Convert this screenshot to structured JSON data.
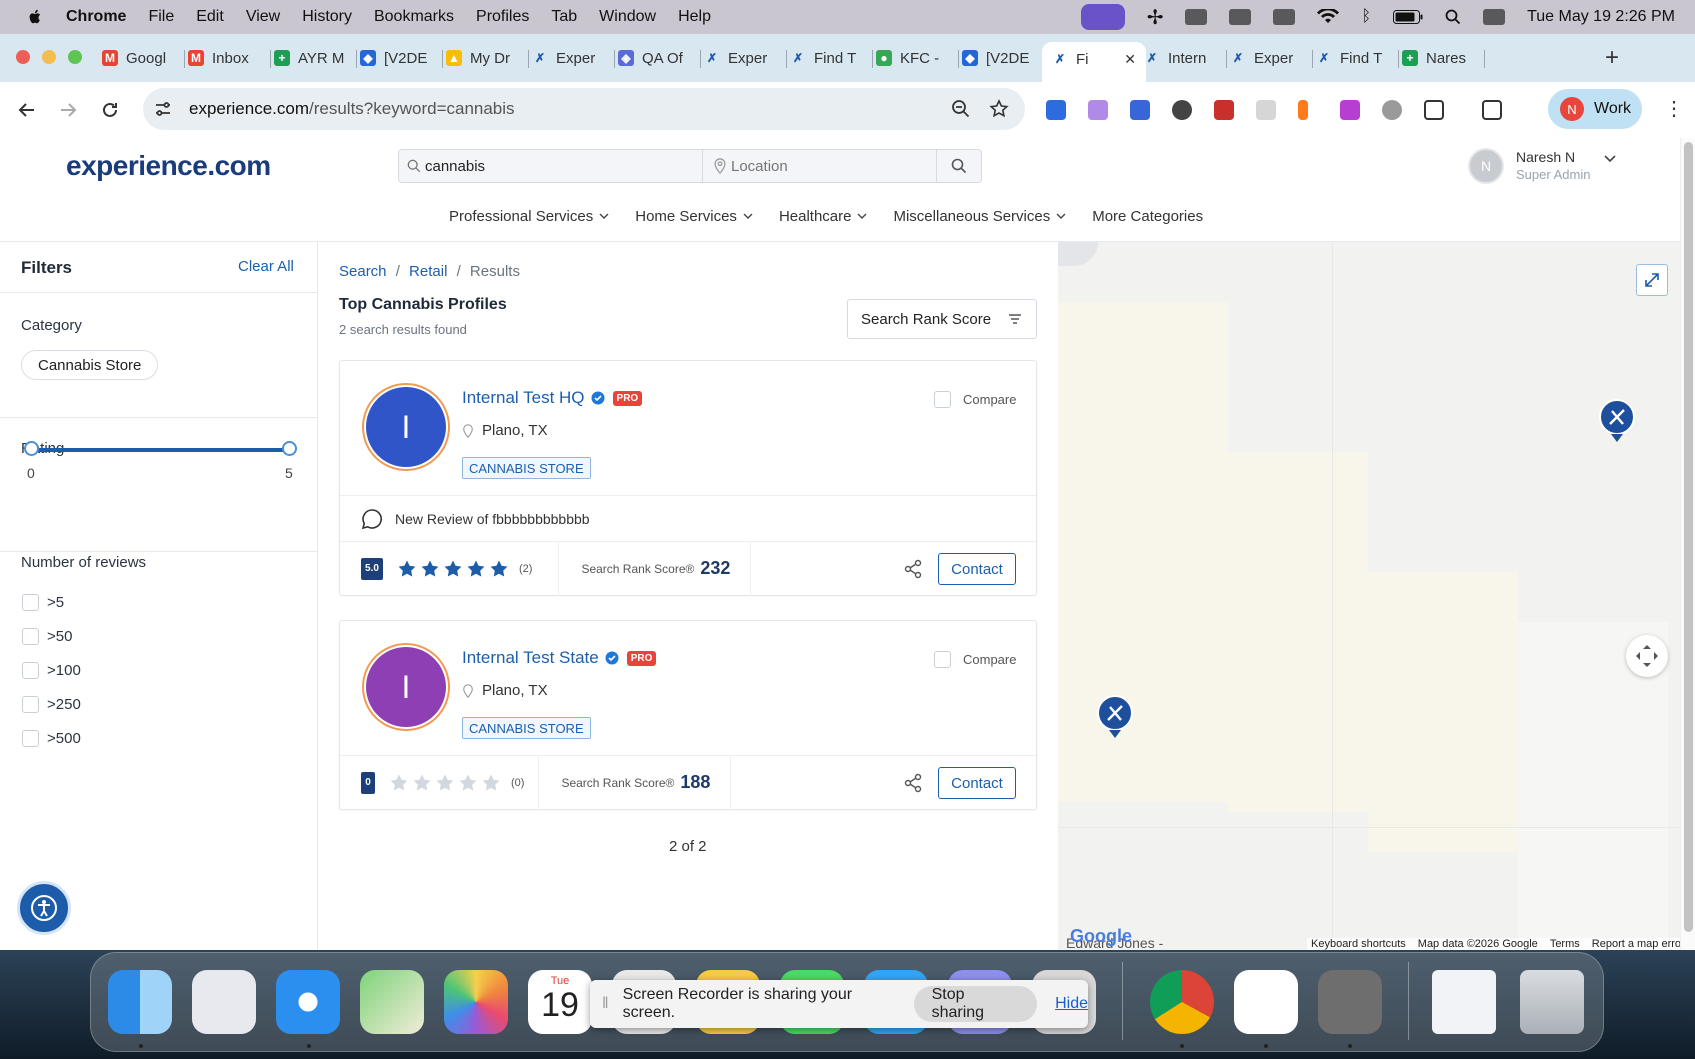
{
  "menubar": {
    "app": "Chrome",
    "items": [
      "File",
      "Edit",
      "View",
      "History",
      "Bookmarks",
      "Profiles",
      "Tab",
      "Window",
      "Help"
    ],
    "clock": "Tue May 19  2:26 PM"
  },
  "tabs": [
    {
      "label": "Googl",
      "icon": "gmail-icon"
    },
    {
      "label": "Inbox",
      "icon": "gmail-icon"
    },
    {
      "label": "AYR M",
      "icon": "sheets-icon"
    },
    {
      "label": "[V2DE",
      "icon": "jira-icon"
    },
    {
      "label": "My Dr",
      "icon": "drive-icon"
    },
    {
      "label": "Exper",
      "icon": "experience-icon"
    },
    {
      "label": "QA Of",
      "icon": "shield-icon"
    },
    {
      "label": "Exper",
      "icon": "experience-icon"
    },
    {
      "label": "Find T",
      "icon": "experience-icon"
    },
    {
      "label": "KFC -",
      "icon": "maps-icon"
    },
    {
      "label": "[V2DE",
      "icon": "jira-icon"
    },
    {
      "label": "Fi",
      "icon": "experience-icon",
      "active": true
    },
    {
      "label": "Intern",
      "icon": "experience-icon"
    },
    {
      "label": "Exper",
      "icon": "experience-icon"
    },
    {
      "label": "Find T",
      "icon": "experience-icon"
    },
    {
      "label": "Nares",
      "icon": "sheets-icon"
    }
  ],
  "omnibox": {
    "domain": "experience.com",
    "path": "/results?keyword=cannabis"
  },
  "profile_button": {
    "initial": "N",
    "label": "Work"
  },
  "site": {
    "logo": "experience.com",
    "search": {
      "keyword": "cannabis",
      "location_placeholder": "Location"
    },
    "user": {
      "initial": "N",
      "name": "Naresh N",
      "role": "Super Admin"
    },
    "categories": [
      "Professional Services",
      "Home Services",
      "Healthcare",
      "Miscellaneous Services",
      "More Categories"
    ]
  },
  "filters": {
    "title": "Filters",
    "clear_all": "Clear All",
    "category_title": "Category",
    "category_chip": "Cannabis Store",
    "rating_title": "Rating",
    "rating_min": "0",
    "rating_max": "5",
    "reviews_title": "Number of reviews",
    "review_options": [
      ">5",
      ">50",
      ">100",
      ">250",
      ">500"
    ]
  },
  "results": {
    "breadcrumb": [
      "Search",
      "Retail",
      "Results"
    ],
    "title": "Top Cannabis Profiles",
    "count": "2 search results found",
    "sort_label": "Search Rank Score",
    "pager": "2 of 2",
    "compare_label": "Compare",
    "contact_label": "Contact",
    "rank_label": "Search Rank Score®",
    "cards": [
      {
        "initial": "I",
        "name": "Internal Test HQ",
        "badge": "PRO",
        "location": "Plano, TX",
        "tag": "CANNABIS STORE",
        "review": "New Review of fbbbbbbbbbbbb",
        "rating": "5.0",
        "stars": 5,
        "reviews": "(2)",
        "rank": "232",
        "color": "#2f55c8"
      },
      {
        "initial": "I",
        "name": "Internal Test State",
        "badge": "PRO",
        "location": "Plano, TX",
        "tag": "CANNABIS STORE",
        "rating": "0",
        "stars": 0,
        "reviews": "(0)",
        "rank": "188",
        "color": "#8e3fb3"
      }
    ]
  },
  "map": {
    "attribution": "Google",
    "place_label": "Edward Jones -",
    "links": [
      "Keyboard shortcuts",
      "Map data ©2026 Google",
      "Terms",
      "Report a map error"
    ]
  },
  "recorder": {
    "message": "Screen Recorder is sharing your screen.",
    "stop": "Stop sharing",
    "hide": "Hide"
  },
  "dock": {
    "calendar_day": "Tue",
    "calendar_date": "19"
  }
}
